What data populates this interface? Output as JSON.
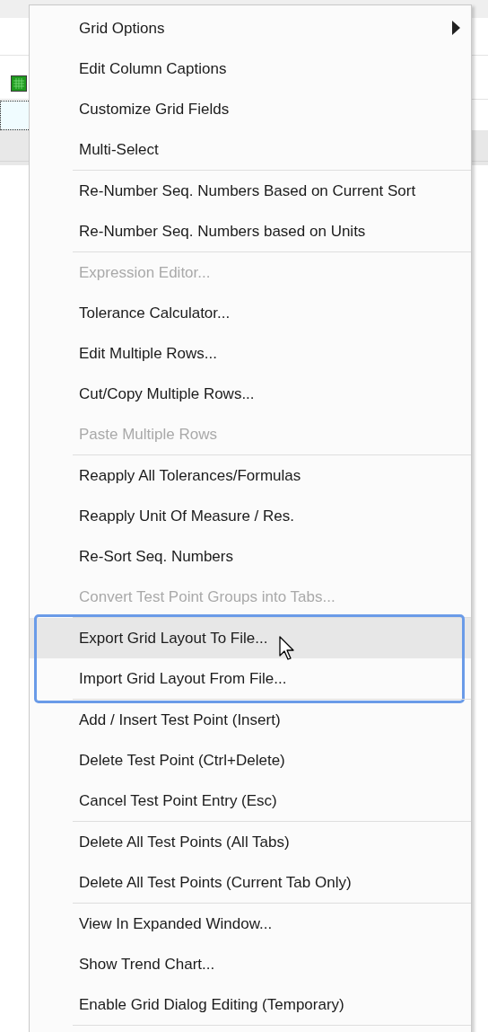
{
  "context_menu": {
    "groups": [
      {
        "highlighted": false,
        "items": [
          {
            "label": "Grid Options",
            "submenu": true,
            "disabled": false,
            "selected": false
          },
          {
            "label": "Edit Column Captions",
            "submenu": false,
            "disabled": false,
            "selected": false
          },
          {
            "label": "Customize Grid Fields",
            "submenu": false,
            "disabled": false,
            "selected": false
          },
          {
            "label": "Multi-Select",
            "submenu": false,
            "disabled": false,
            "selected": false
          }
        ]
      },
      {
        "highlighted": false,
        "items": [
          {
            "label": "Re-Number Seq. Numbers Based on Current Sort",
            "submenu": false,
            "disabled": false,
            "selected": false
          },
          {
            "label": "Re-Number Seq. Numbers based on Units",
            "submenu": false,
            "disabled": false,
            "selected": false
          }
        ]
      },
      {
        "highlighted": false,
        "items": [
          {
            "label": "Expression Editor...",
            "submenu": false,
            "disabled": true,
            "selected": false
          },
          {
            "label": "Tolerance Calculator...",
            "submenu": false,
            "disabled": false,
            "selected": false
          },
          {
            "label": "Edit Multiple Rows...",
            "submenu": false,
            "disabled": false,
            "selected": false
          },
          {
            "label": "Cut/Copy Multiple Rows...",
            "submenu": false,
            "disabled": false,
            "selected": false
          },
          {
            "label": "Paste Multiple Rows",
            "submenu": false,
            "disabled": true,
            "selected": false
          }
        ]
      },
      {
        "highlighted": false,
        "items": [
          {
            "label": "Reapply All Tolerances/Formulas",
            "submenu": false,
            "disabled": false,
            "selected": false
          },
          {
            "label": "Reapply Unit Of Measure / Res.",
            "submenu": false,
            "disabled": false,
            "selected": false
          },
          {
            "label": "Re-Sort Seq. Numbers",
            "submenu": false,
            "disabled": false,
            "selected": false
          },
          {
            "label": "Convert Test Point Groups into Tabs...",
            "submenu": false,
            "disabled": true,
            "selected": false
          }
        ]
      },
      {
        "highlighted": true,
        "items": [
          {
            "label": "Export Grid Layout To File...",
            "submenu": false,
            "disabled": false,
            "selected": true
          },
          {
            "label": "Import Grid Layout From File...",
            "submenu": false,
            "disabled": false,
            "selected": false
          }
        ]
      },
      {
        "highlighted": false,
        "items": [
          {
            "label": "Add / Insert Test Point (Insert)",
            "submenu": false,
            "disabled": false,
            "selected": false
          },
          {
            "label": "Delete Test Point (Ctrl+Delete)",
            "submenu": false,
            "disabled": false,
            "selected": false
          },
          {
            "label": "Cancel Test Point Entry (Esc)",
            "submenu": false,
            "disabled": false,
            "selected": false
          }
        ]
      },
      {
        "highlighted": false,
        "items": [
          {
            "label": "Delete All Test Points (All Tabs)",
            "submenu": false,
            "disabled": false,
            "selected": false
          },
          {
            "label": "Delete All Test Points (Current Tab Only)",
            "submenu": false,
            "disabled": false,
            "selected": false
          }
        ]
      },
      {
        "highlighted": false,
        "items": [
          {
            "label": "View In Expanded Window...",
            "submenu": false,
            "disabled": false,
            "selected": false
          },
          {
            "label": "Show Trend Chart...",
            "submenu": false,
            "disabled": false,
            "selected": false
          },
          {
            "label": "Enable Grid Dialog Editing (Temporary)",
            "submenu": false,
            "disabled": false,
            "selected": false
          }
        ]
      }
    ]
  }
}
